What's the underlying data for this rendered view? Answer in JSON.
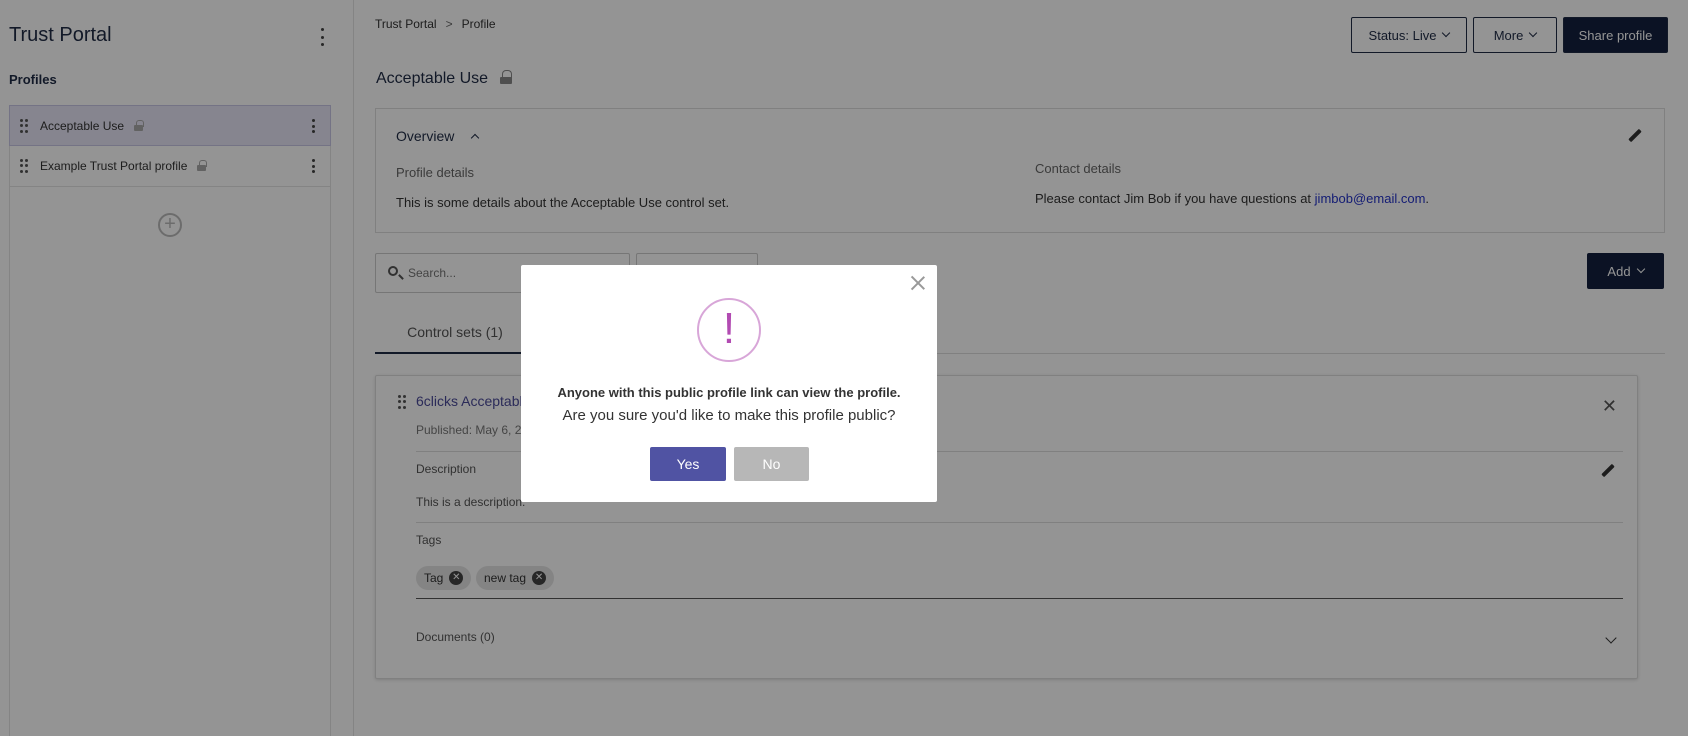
{
  "sidebar": {
    "title": "Trust Portal",
    "section_label": "Profiles",
    "items": [
      {
        "label": "Acceptable Use"
      },
      {
        "label": "Example Trust Portal profile"
      }
    ],
    "add_symbol": "+"
  },
  "header": {
    "breadcrumb": {
      "root": "Trust Portal",
      "separator": ">",
      "current": "Profile"
    },
    "status_prefix": "Status: ",
    "status_value": "Live",
    "more_label": "More",
    "share_label": "Share profile"
  },
  "page": {
    "title": "Acceptable Use"
  },
  "overview": {
    "heading": "Overview",
    "profile_details_label": "Profile details",
    "profile_details_text": "This is some details about the Acceptable Use control set.",
    "contact_details_label": "Contact details",
    "contact_text": "Please contact Jim Bob if you have questions at ",
    "contact_email": "jimbob@email.com",
    "contact_suffix": "."
  },
  "search": {
    "placeholder": "Search..."
  },
  "add_button": {
    "label": "Add"
  },
  "tabs": [
    {
      "label": "Control sets (1)"
    }
  ],
  "card": {
    "title": "6clicks Acceptabl",
    "published": "Published: May 6, 2",
    "description_label": "Description",
    "description_text": "This is a description.",
    "tags_label": "Tags",
    "tags": [
      "Tag",
      "new tag"
    ],
    "documents_label": "Documents (0)"
  },
  "modal": {
    "icon_glyph": "!",
    "line1": "Anyone with this public profile link can view the profile.",
    "line2": "Are you sure you'd like to make this profile public?",
    "yes_label": "Yes",
    "no_label": "No"
  },
  "colors": {
    "primary_dark": "#13203f",
    "accent_purple": "#5053a3",
    "warning_pink": "#b24bb2",
    "link_blue": "#2432c9"
  }
}
